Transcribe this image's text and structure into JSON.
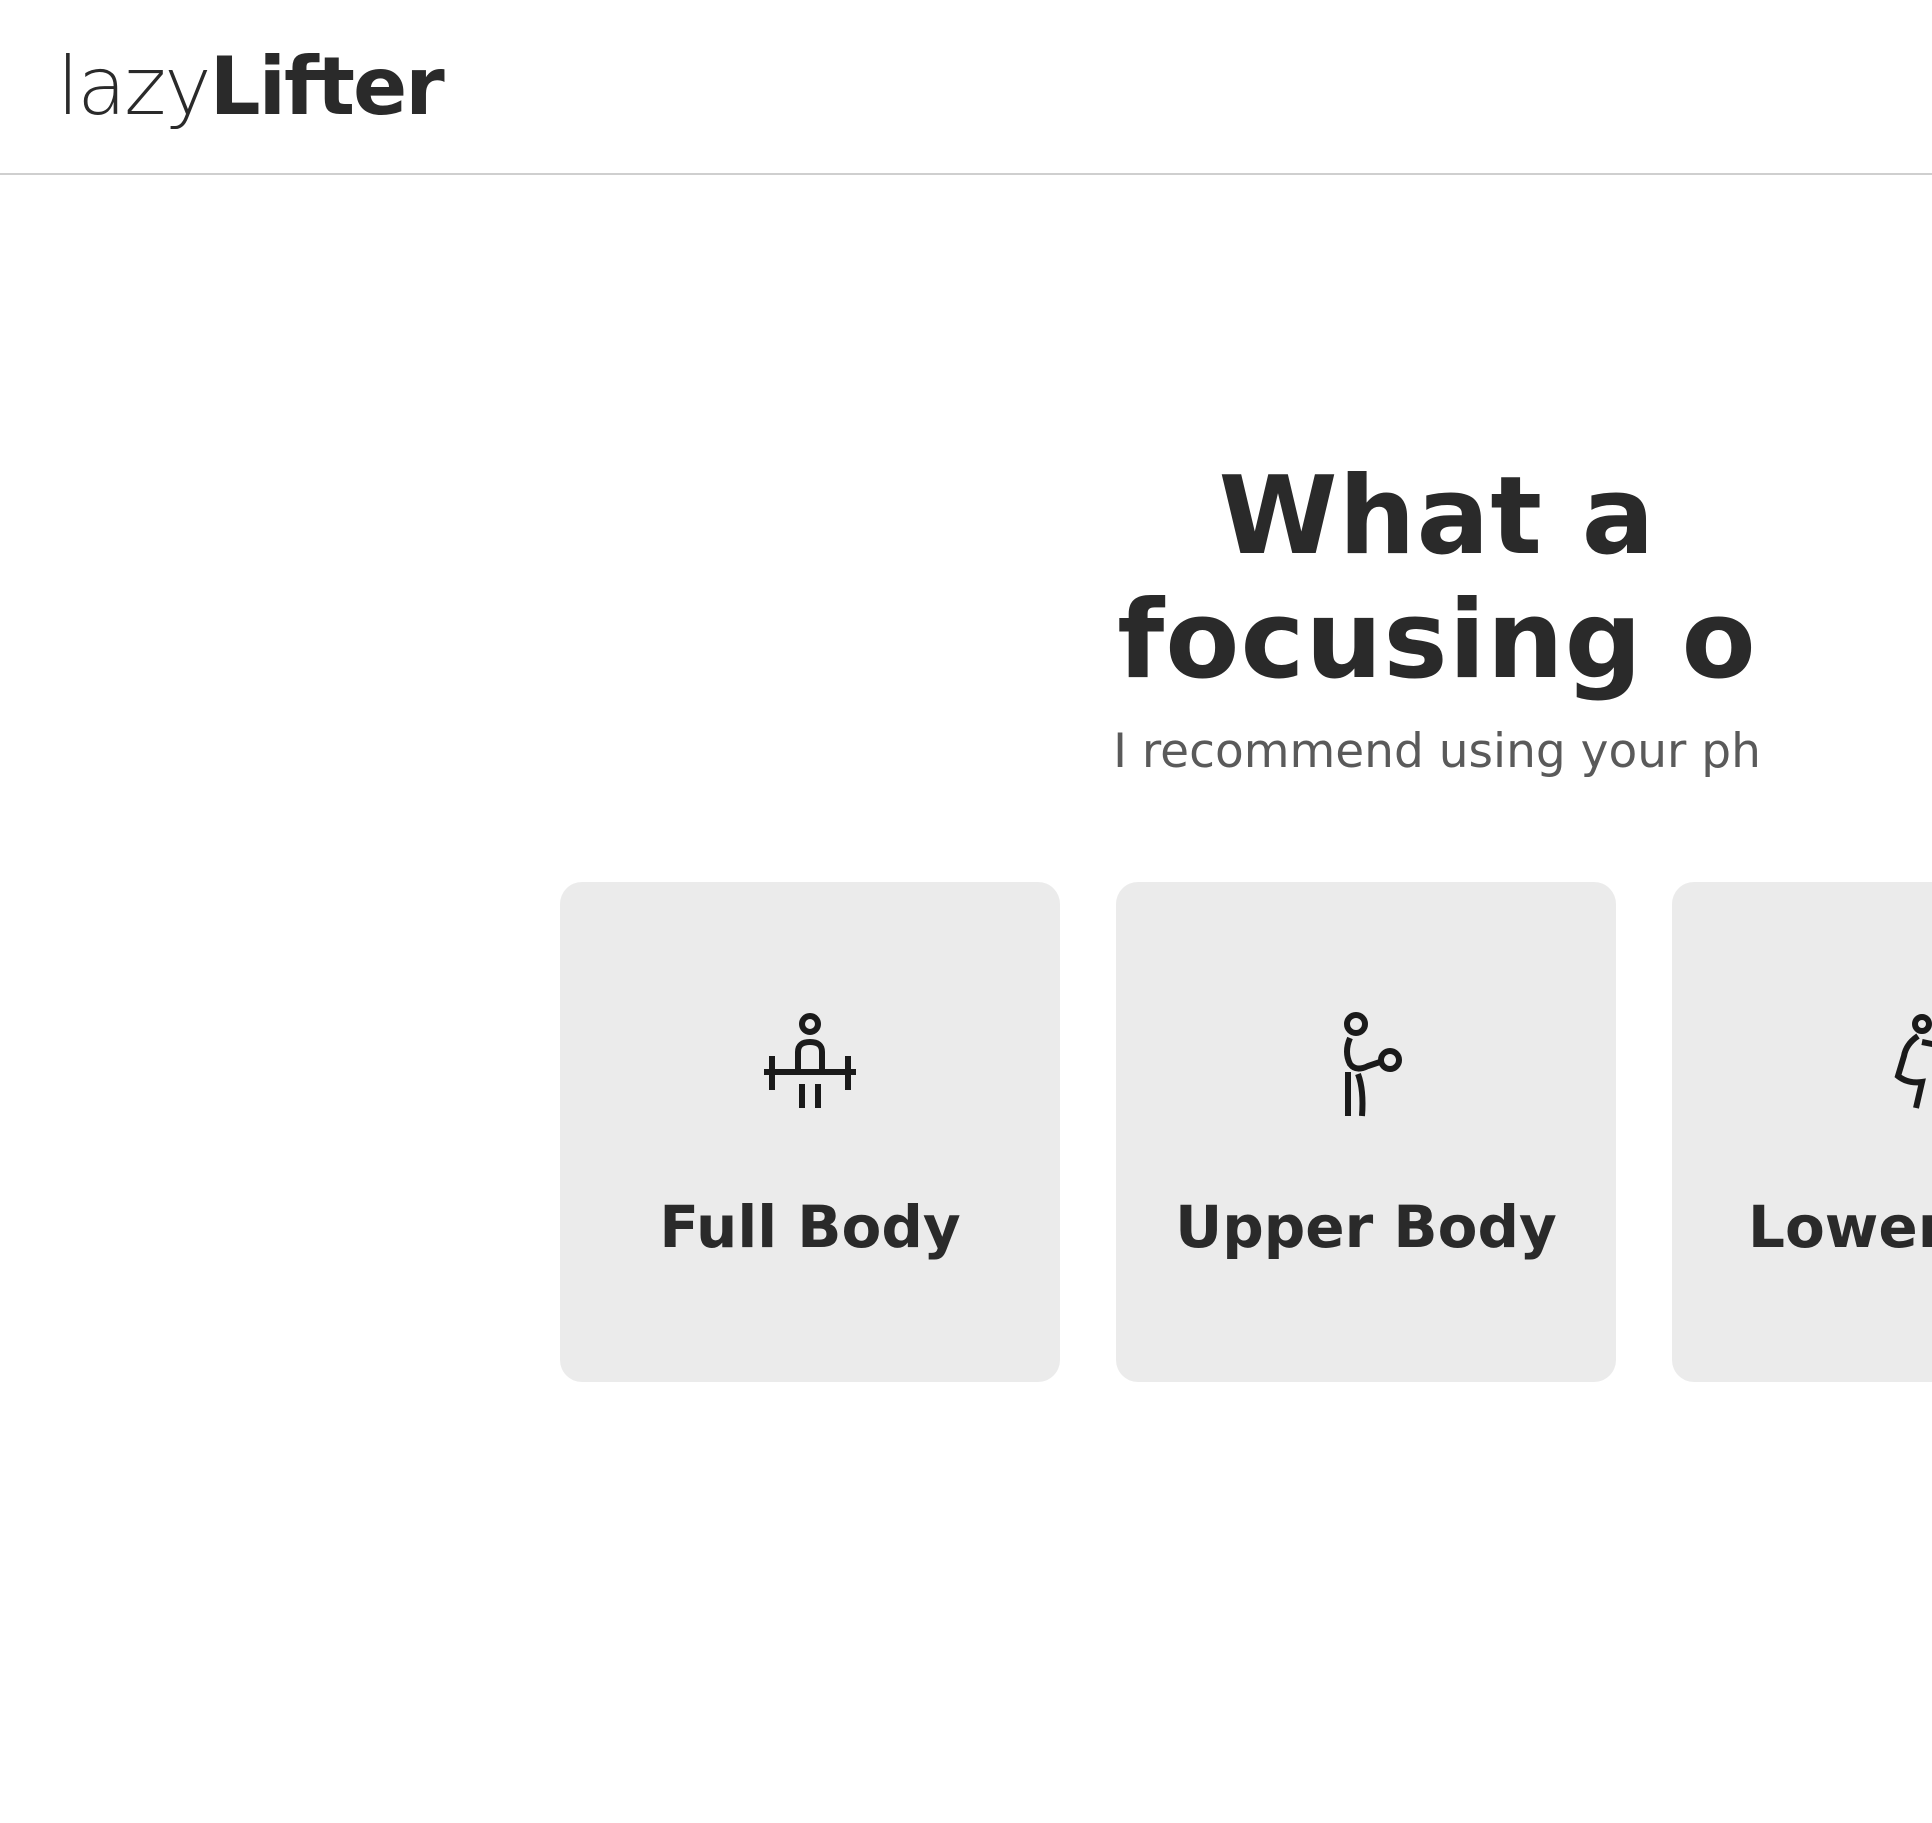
{
  "app": {
    "logo_light": "lazy",
    "logo_bold": "Lifter"
  },
  "hero": {
    "title_line1": "What a",
    "title_line2": "focusing o",
    "subtitle": "I recommend using your ph"
  },
  "options": [
    {
      "label": "Full Body",
      "icon": "barbell-lift-icon"
    },
    {
      "label": "Upper Body",
      "icon": "arm-curl-icon"
    },
    {
      "label": "Lower",
      "icon": "squat-icon"
    }
  ],
  "colors": {
    "text": "#2a2a2a",
    "subtext": "#5a5a5a",
    "card_bg": "#ebebeb",
    "divider": "#cfcfcf"
  }
}
